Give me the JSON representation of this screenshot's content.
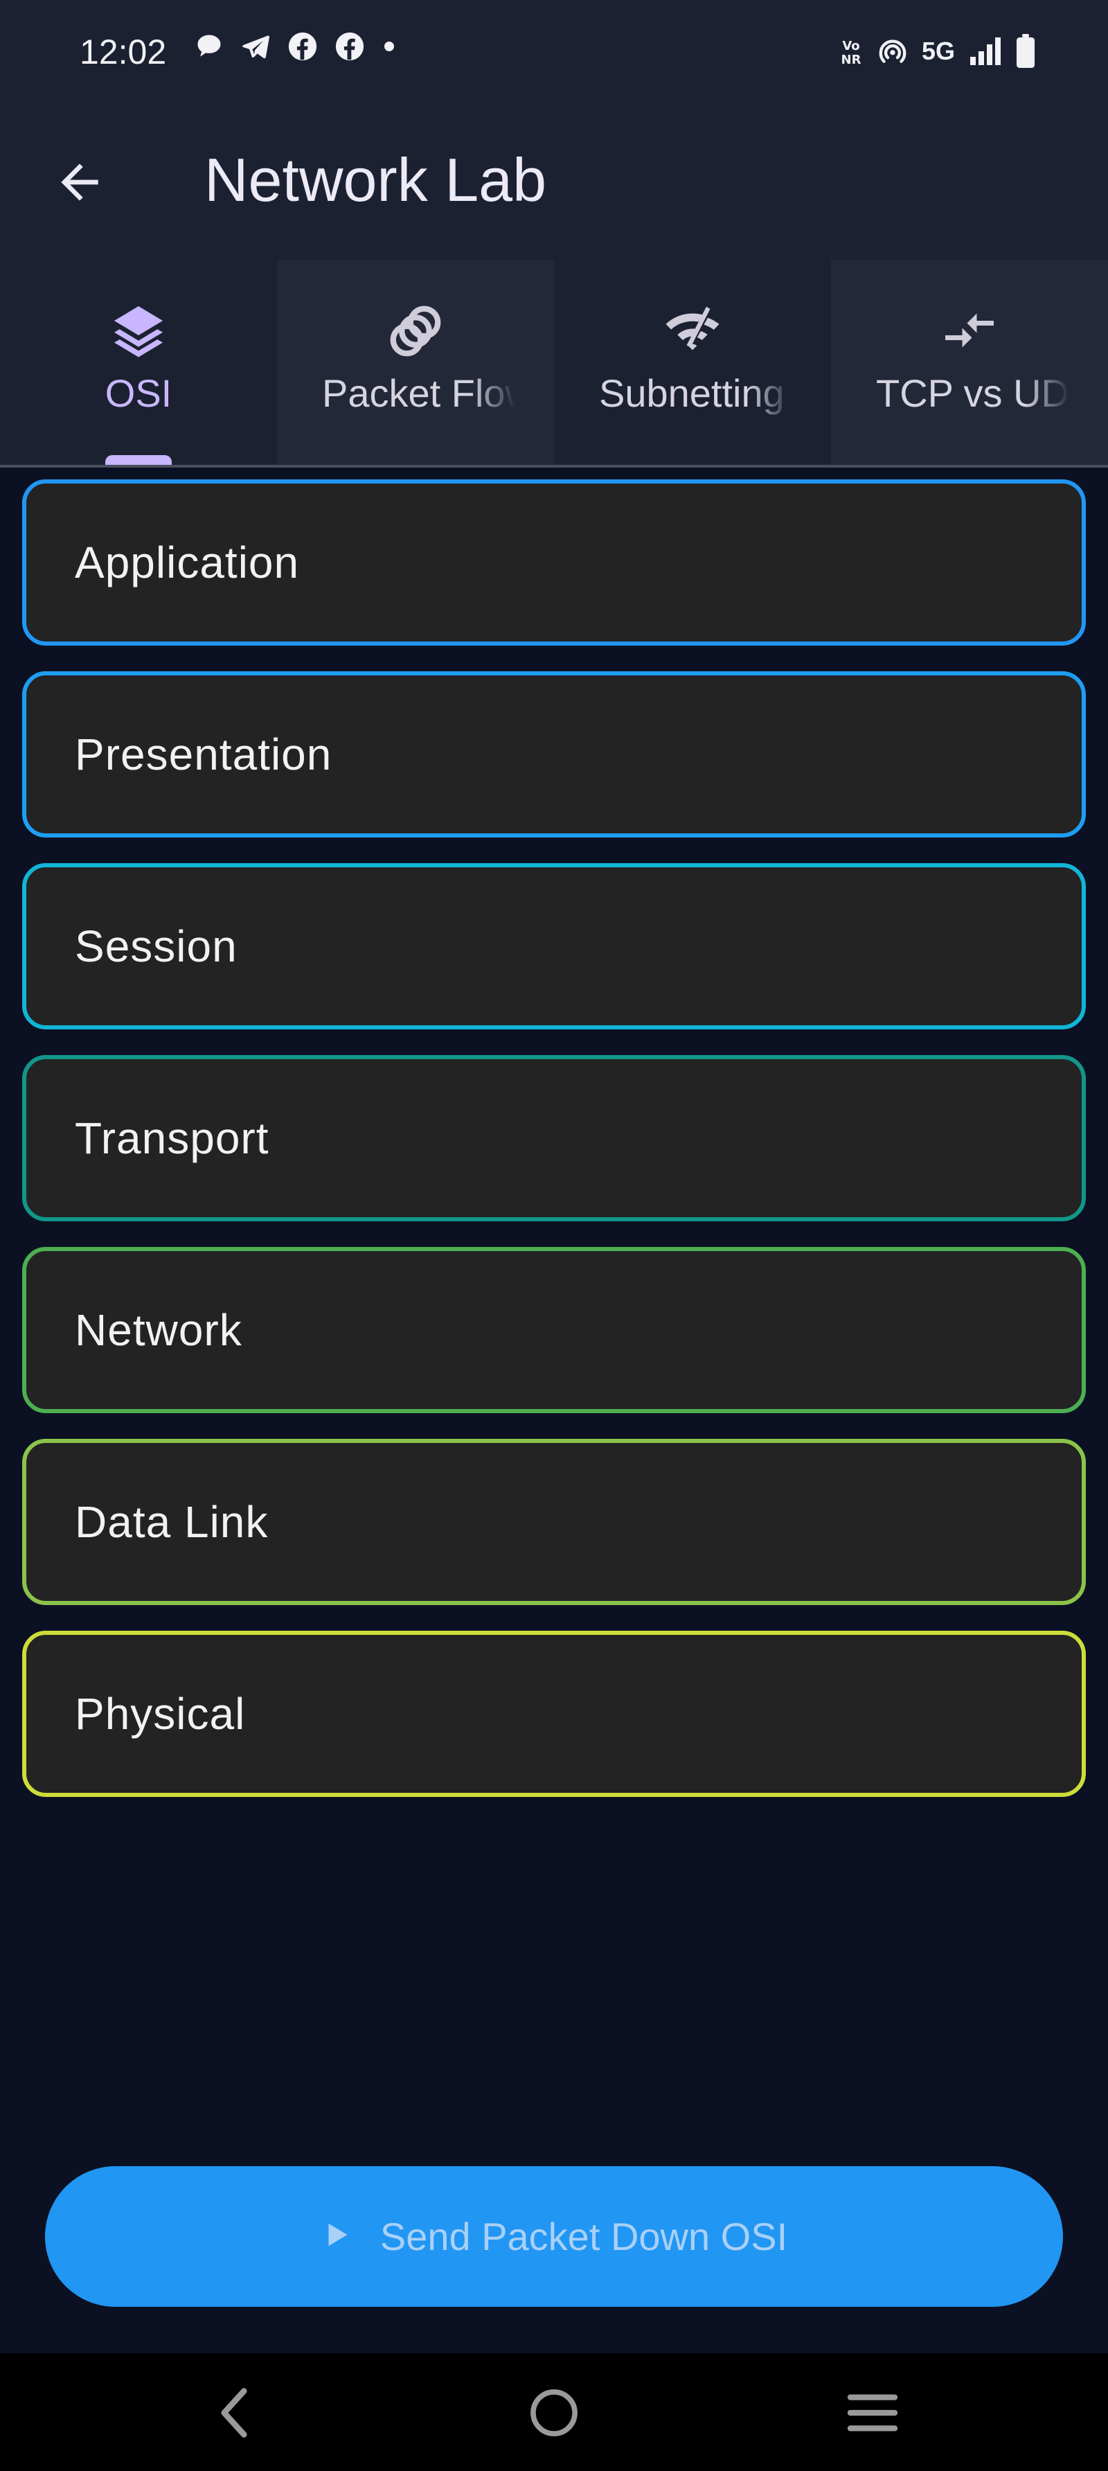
{
  "status_bar": {
    "time": "12:02",
    "network": "5G",
    "left_icons": [
      "chat-bubble-icon",
      "telegram-icon",
      "facebook-icon",
      "facebook-icon",
      "dot-icon"
    ],
    "right_icons": [
      "vonr-icon",
      "hotspot-icon",
      "signal-icon",
      "battery-icon"
    ]
  },
  "app_bar": {
    "title": "Network Lab",
    "back_icon": "arrow-left-icon"
  },
  "tabs": [
    {
      "label": "OSI",
      "icon": "layers-icon",
      "active": true
    },
    {
      "label": "Packet Flow",
      "icon": "rings-icon",
      "active": false
    },
    {
      "label": "Subnetting",
      "icon": "wifi-off-icon",
      "active": false
    },
    {
      "label": "TCP vs UDP",
      "icon": "compare-arrows-icon",
      "active": false
    }
  ],
  "layers": [
    {
      "name": "Application",
      "color": "#2196f3"
    },
    {
      "name": "Presentation",
      "color": "#1e9ef2"
    },
    {
      "name": "Session",
      "color": "#12b5d6"
    },
    {
      "name": "Transport",
      "color": "#13968a"
    },
    {
      "name": "Network",
      "color": "#4caf50"
    },
    {
      "name": "Data Link",
      "color": "#8bc34a"
    },
    {
      "name": "Physical",
      "color": "#cddc39"
    }
  ],
  "action": {
    "label": "Send Packet Down OSI",
    "icon": "play-icon",
    "color": "#2196f3"
  },
  "nav_bar": {
    "icons": [
      "nav-back-icon",
      "nav-home-icon",
      "nav-menu-icon"
    ]
  }
}
